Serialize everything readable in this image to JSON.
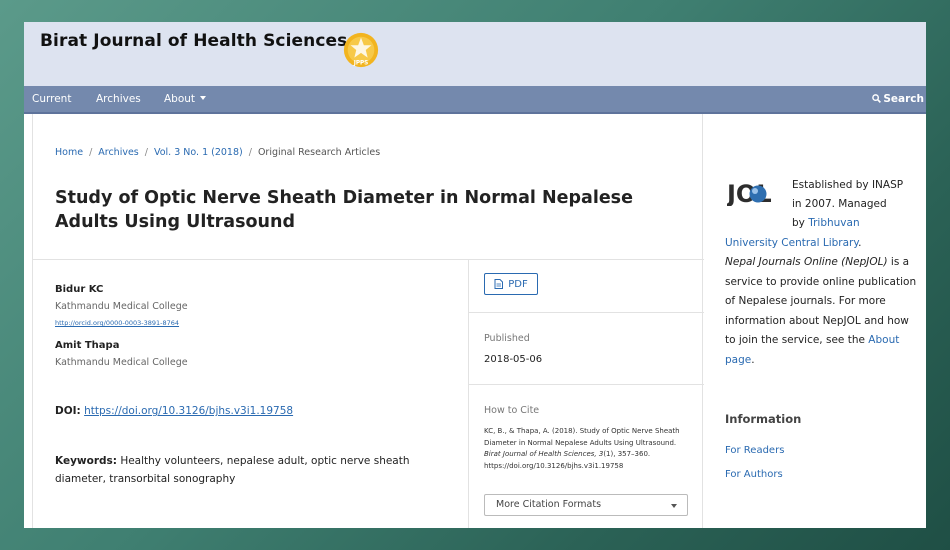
{
  "header": {
    "site_title": "Birat Journal of Health Sciences",
    "logo_text": "JPPS"
  },
  "nav": {
    "current": "Current",
    "archives": "Archives",
    "about": "About",
    "search": "Search"
  },
  "breadcrumb": {
    "home": "Home",
    "archives": "Archives",
    "volume": "Vol. 3 No. 1 (2018)",
    "section": "Original Research Articles"
  },
  "article": {
    "title": "Study of Optic Nerve Sheath Diameter in Normal Nepalese Adults Using Ultrasound",
    "authors": [
      {
        "name": "Bidur KC",
        "affiliation": "Kathmandu Medical College",
        "orcid": "http://orcid.org/0000-0003-3891-8764"
      },
      {
        "name": "Amit Thapa",
        "affiliation": "Kathmandu Medical College"
      }
    ],
    "doi_label": "DOI:",
    "doi_url": "https://doi.org/10.3126/bjhs.v3i1.19758",
    "keywords_label": "Keywords:",
    "keywords": "Healthy volunteers, nepalese adult, optic nerve sheath diameter, transorbital sonography"
  },
  "details": {
    "pdf_label": "PDF",
    "published_label": "Published",
    "published_date": "2018-05-06",
    "cite_label": "How to Cite",
    "citation_pre": "KC, B., & Thapa, A. (2018). Study of Optic Nerve Sheath Diameter in Normal Nepalese Adults Using Ultrasound. ",
    "citation_journal": "Birat Journal of Health Sciences",
    "citation_vol": ", 3",
    "citation_post": "(1), 357–360. https://doi.org/10.3126/bjhs.v3i1.19758",
    "more_formats": "More Citation Formats"
  },
  "sidebar": {
    "logo_text": "JOL",
    "line1": "Established by INASP",
    "line2": "in 2007. Managed",
    "line3_pre": "by ",
    "line3_link": "Tribhuvan",
    "line4_link": "University Central Library",
    "line4_post": ".",
    "nepjol_name": "Nepal Journals Online (NepJOL)",
    "nepjol_desc": " is a service to provide online publication of Nepalese journals. For more information about NepJOL and how to join the service, see the ",
    "about_link": "About page",
    "about_post": ".",
    "info_heading": "Information",
    "for_readers": "For Readers",
    "for_authors": "For Authors"
  },
  "colors": {
    "link": "#2a6ab1",
    "navbar": "#7489ad",
    "header_bg": "#dde3f0",
    "logo_gold": "#f2b41f"
  }
}
